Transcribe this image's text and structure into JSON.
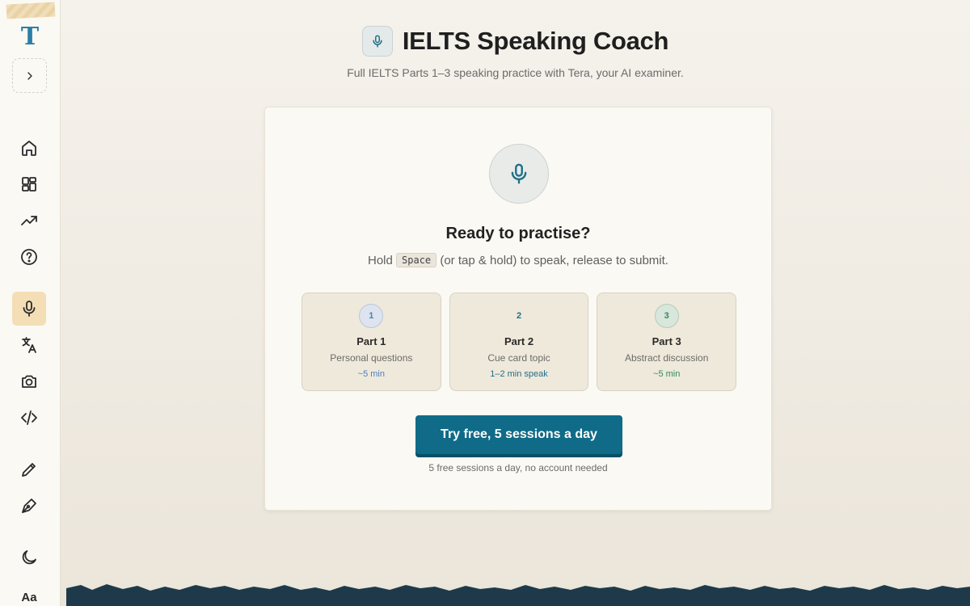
{
  "sidebar": {
    "logo_letter": "T",
    "nav": [
      {
        "id": "home",
        "icon": "home-icon"
      },
      {
        "id": "dashboard",
        "icon": "grid-icon"
      },
      {
        "id": "progress",
        "icon": "trending-up-icon"
      },
      {
        "id": "help",
        "icon": "help-circle-icon"
      },
      {
        "id": "speaking",
        "icon": "microphone-icon",
        "active": true
      },
      {
        "id": "translate",
        "icon": "translate-icon"
      },
      {
        "id": "camera",
        "icon": "camera-icon"
      },
      {
        "id": "code",
        "icon": "code-icon"
      },
      {
        "id": "write",
        "icon": "pencil-icon"
      },
      {
        "id": "pen",
        "icon": "pen-tool-icon"
      },
      {
        "id": "theme",
        "icon": "moon-icon"
      }
    ],
    "font_toggle": "Aa"
  },
  "header": {
    "title": "IELTS Speaking Coach",
    "subtitle": "Full IELTS Parts 1–3 speaking practice with Tera, your AI examiner."
  },
  "card": {
    "heading": "Ready to practise?",
    "hint_prefix": "Hold",
    "hint_key": "Space",
    "hint_suffix": "(or tap & hold) to speak, release to submit.",
    "parts": [
      {
        "number": "1",
        "name": "Part 1",
        "description": "Personal questions",
        "duration": "~5 min",
        "color": "#4a7fc1",
        "badge_bg": "#dde4ef",
        "badge_border": "#b9c6da"
      },
      {
        "number": "2",
        "name": "Part 2",
        "description": "Cue card topic",
        "duration": "1–2 min speak",
        "color": "#1f6f89",
        "badge_bg": "transparent",
        "badge_border": "transparent"
      },
      {
        "number": "3",
        "name": "Part 3",
        "description": "Abstract discussion",
        "duration": "~5 min",
        "color": "#2f8a5a",
        "badge_bg": "#d9e6dc",
        "badge_border": "#b2cdb9"
      }
    ],
    "cta_label": "Try free, 5 sessions a day",
    "cta_note": "5 free sessions a day, no account needed"
  },
  "colors": {
    "accent": "#0f6b87",
    "active_nav": "#f4deb6",
    "mountains": "#1e3a4a"
  }
}
